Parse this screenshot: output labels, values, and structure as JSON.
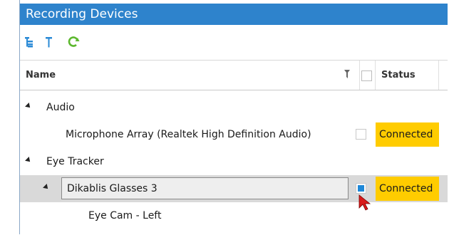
{
  "window": {
    "title": "Recording Devices"
  },
  "toolbar": {
    "icons": [
      "expand-all-icon",
      "collapse-all-icon",
      "refresh-icon"
    ],
    "colors": {
      "expand": "#2a8ad6",
      "collapse": "#2a8ad6",
      "refresh": "#5cb82e"
    }
  },
  "grid": {
    "columns": {
      "name": "Name",
      "status": "Status"
    },
    "rows": [
      {
        "level": 0,
        "label": "Audio",
        "expanded": true
      },
      {
        "level": 1,
        "label": "Microphone Array (Realtek High Definition Audio)",
        "checked": false,
        "status": "Connected"
      },
      {
        "level": 0,
        "label": "Eye Tracker",
        "expanded": true
      },
      {
        "level": 1,
        "label": "Dikablis Glasses 3",
        "expanded": true,
        "checked": true,
        "status": "Connected",
        "selected": true
      },
      {
        "level": 2,
        "label": "Eye Cam - Left"
      }
    ]
  },
  "colors": {
    "title_bar": "#2e83cc",
    "status_connected": "#ffcc00",
    "check_accent": "#1e88d8",
    "cursor": "#d91a1a"
  }
}
